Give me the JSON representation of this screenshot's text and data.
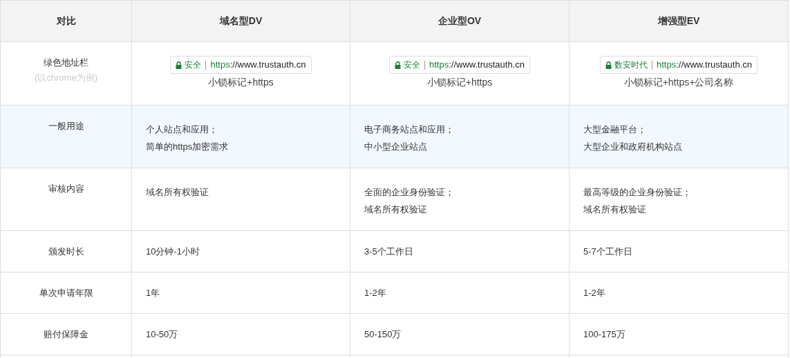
{
  "table": {
    "columns": [
      "对比",
      "域名型DV",
      "企业型OV",
      "增强型EV"
    ],
    "rows": [
      {
        "label": "绿色地址栏",
        "note": "(以chrome为例)",
        "highlighted": false,
        "kind": "address",
        "cells": [
          {
            "badge": "安全",
            "scheme": "https",
            "rest": "://www.trustauth.cn",
            "caption": "小锁标记+https"
          },
          {
            "badge": "安全",
            "scheme": "https",
            "rest": "://www.trustauth.cn",
            "caption": "小锁标记+https"
          },
          {
            "badge": "数安时代",
            "scheme": "https",
            "rest": "://www.trustauth.cn",
            "caption": "小锁标记+https+公司名称"
          }
        ]
      },
      {
        "label": "一般用途",
        "highlighted": true,
        "kind": "text",
        "cells": [
          {
            "lines": [
              "个人站点和应用；",
              "简单的https加密需求"
            ]
          },
          {
            "lines": [
              "电子商务站点和应用；",
              "中小型企业站点"
            ]
          },
          {
            "lines": [
              "大型金融平台；",
              "大型企业和政府机构站点"
            ]
          }
        ]
      },
      {
        "label": "审核内容",
        "highlighted": false,
        "kind": "text",
        "cells": [
          {
            "lines": [
              "域名所有权验证"
            ]
          },
          {
            "lines": [
              "全面的企业身份验证；",
              "域名所有权验证"
            ]
          },
          {
            "lines": [
              "最高等级的企业身份验证；",
              "域名所有权验证"
            ]
          }
        ]
      },
      {
        "label": "颁发时长",
        "highlighted": false,
        "kind": "short",
        "cells": [
          {
            "lines": [
              "10分钟-1小时"
            ]
          },
          {
            "lines": [
              "3-5个工作日"
            ]
          },
          {
            "lines": [
              "5-7个工作日"
            ]
          }
        ]
      },
      {
        "label": "单次申请年限",
        "highlighted": false,
        "kind": "short",
        "cells": [
          {
            "lines": [
              "1年"
            ]
          },
          {
            "lines": [
              "1-2年"
            ]
          },
          {
            "lines": [
              "1-2年"
            ]
          }
        ]
      },
      {
        "label": "赔付保障金",
        "highlighted": false,
        "kind": "short",
        "cells": [
          {
            "lines": [
              "10-50万"
            ]
          },
          {
            "lines": [
              "50-150万"
            ]
          },
          {
            "lines": [
              "100-175万"
            ]
          }
        ]
      }
    ]
  }
}
